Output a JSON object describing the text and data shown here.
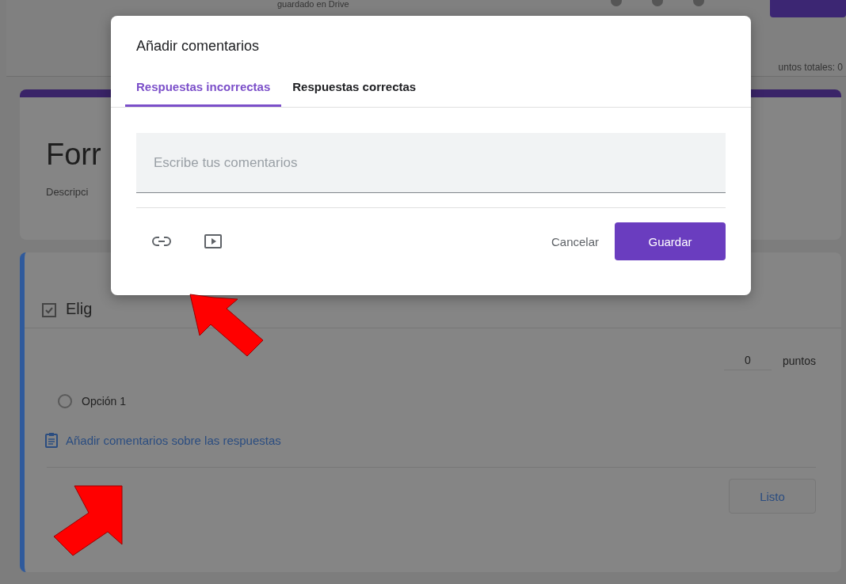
{
  "header": {
    "save_status": "guardado en Drive",
    "total_points": "untos totales: 0"
  },
  "form": {
    "title": "Forr",
    "description": "Descripci"
  },
  "question": {
    "title": "Elig",
    "points": "0",
    "points_label": "puntos",
    "options": [
      {
        "label": "Opción 1",
        "selected": false
      }
    ],
    "feedback_link": "Añadir comentarios sobre las respuestas",
    "done_button": "Listo"
  },
  "dialog": {
    "title": "Añadir comentarios",
    "tabs": [
      {
        "label": "Respuestas incorrectas",
        "selected": true
      },
      {
        "label": "Respuestas correctas",
        "selected": false
      }
    ],
    "comment_field": {
      "placeholder": "Escribe tus comentarios"
    },
    "cancel_button": "Cancelar",
    "save_button": "Guardar"
  }
}
